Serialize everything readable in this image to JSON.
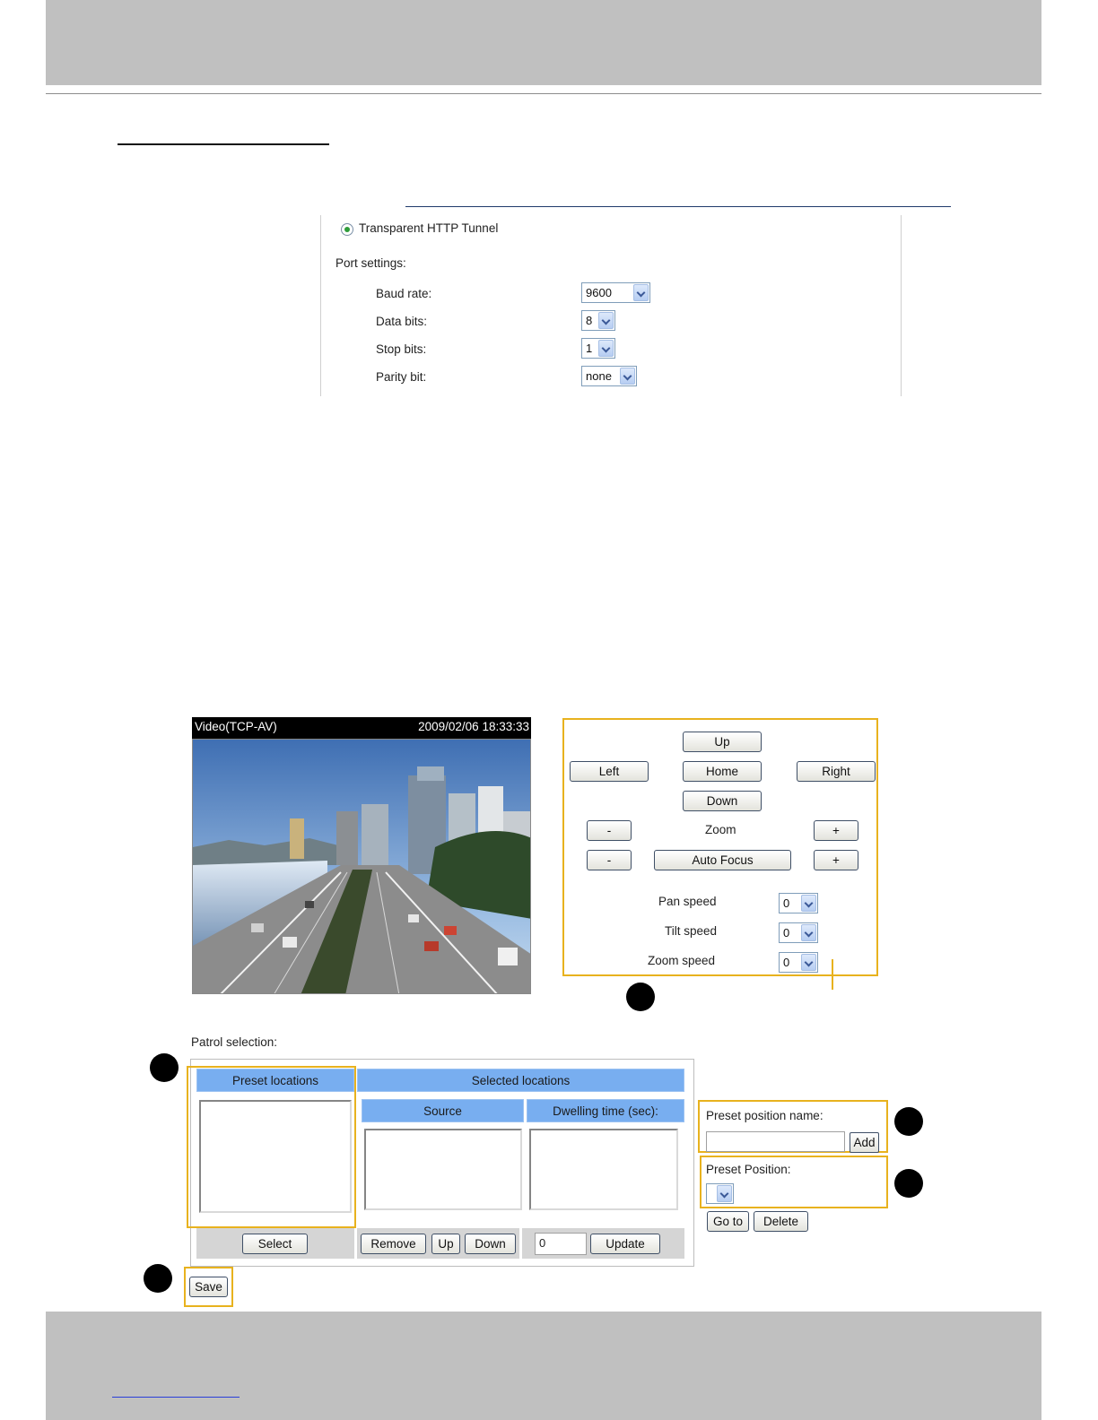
{
  "serial": {
    "mode_label": "Transparent HTTP Tunnel",
    "port_settings_label": "Port settings:",
    "fields": [
      {
        "label": "Baud rate:",
        "value": "9600"
      },
      {
        "label": "Data bits:",
        "value": "8"
      },
      {
        "label": "Stop bits:",
        "value": "1"
      },
      {
        "label": "Parity bit:",
        "value": "none"
      }
    ]
  },
  "video": {
    "title": "Video(TCP-AV)",
    "timestamp": "2009/02/06 18:33:33"
  },
  "ptz": {
    "up": "Up",
    "left": "Left",
    "home": "Home",
    "right": "Right",
    "down": "Down",
    "zoom_label": "Zoom",
    "minus": "-",
    "plus": "+",
    "auto_focus": "Auto Focus",
    "pan_speed_label": "Pan speed",
    "pan_speed": "0",
    "tilt_speed_label": "Tilt speed",
    "tilt_speed": "0",
    "zoom_speed_label": "Zoom speed",
    "zoom_speed": "0"
  },
  "patrol": {
    "title": "Patrol selection:",
    "preset_locations": "Preset locations",
    "selected_locations": "Selected locations",
    "source": "Source",
    "dwelling": "Dwelling time (sec):",
    "select_btn": "Select",
    "remove_btn": "Remove",
    "up_btn": "Up",
    "down_btn": "Down",
    "dwell_value": "0",
    "update_btn": "Update",
    "save_btn": "Save"
  },
  "preset": {
    "name_label": "Preset position name:",
    "name_value": "",
    "add_btn": "Add",
    "position_label": "Preset Position:",
    "goto_btn": "Go to",
    "delete_btn": "Delete"
  },
  "colors": {
    "highlight": "#e8b21e",
    "table_header": "#78aef0",
    "chrome_gray": "#c0c0c0"
  }
}
